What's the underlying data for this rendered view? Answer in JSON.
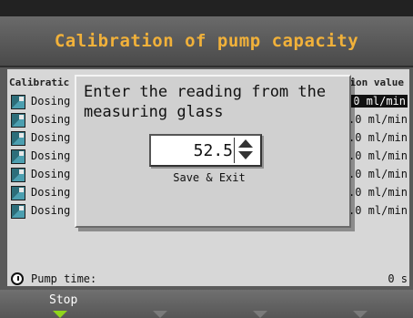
{
  "window": {
    "title": "Calibration of pump capacity"
  },
  "table": {
    "header_left": "Calibratic",
    "header_right": "ion value",
    "rows": [
      {
        "label": "Dosing",
        "value": "3.0 ml/min",
        "selected": true
      },
      {
        "label": "Dosing",
        "value": "3.0 ml/min"
      },
      {
        "label": "Dosing",
        "value": "3.0 ml/min"
      },
      {
        "label": "Dosing",
        "value": "3.0 ml/min"
      },
      {
        "label": "Dosing",
        "value": "3.0 ml/min"
      },
      {
        "label": "Dosing",
        "value": "3.0 ml/min"
      },
      {
        "label": "Dosing pump 7:",
        "value": "92.0 ml/min"
      }
    ]
  },
  "pump_time": {
    "label": "Pump time:",
    "value": "0 s"
  },
  "footer": {
    "stop_label": "Stop"
  },
  "dialog": {
    "prompt_line1": "Enter the reading from the",
    "prompt_line2": "measuring glass",
    "value": "52.5",
    "save_label": "Save & Exit"
  },
  "colors": {
    "title": "#f1b13a",
    "active_softkey": "#8fd51b"
  },
  "icons": {
    "row_icon": "pump-icon",
    "clock_icon": "clock-icon",
    "spin_up": "arrow-up-icon",
    "spin_down": "arrow-down-icon"
  }
}
